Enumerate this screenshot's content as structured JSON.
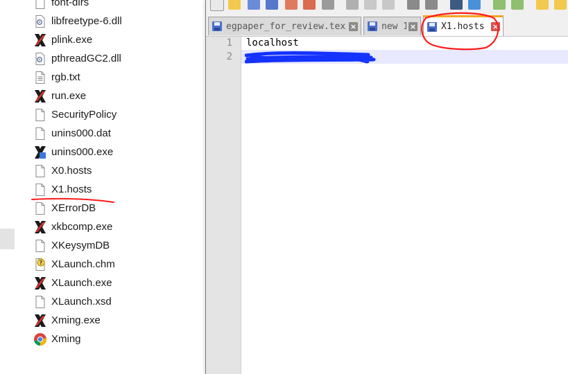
{
  "files": [
    {
      "name": "font-dirs",
      "icon": "document-icon"
    },
    {
      "name": "libfreetype-6.dll",
      "icon": "dll-gear-icon"
    },
    {
      "name": "plink.exe",
      "icon": "x-app-icon"
    },
    {
      "name": "pthreadGC2.dll",
      "icon": "dll-gear-icon"
    },
    {
      "name": "rgb.txt",
      "icon": "text-file-icon"
    },
    {
      "name": "run.exe",
      "icon": "x-app-icon"
    },
    {
      "name": "SecurityPolicy",
      "icon": "document-icon"
    },
    {
      "name": "unins000.dat",
      "icon": "document-icon"
    },
    {
      "name": "unins000.exe",
      "icon": "uninstall-icon"
    },
    {
      "name": "X0.hosts",
      "icon": "document-icon"
    },
    {
      "name": "X1.hosts",
      "icon": "document-icon"
    },
    {
      "name": "XErrorDB",
      "icon": "document-icon"
    },
    {
      "name": "xkbcomp.exe",
      "icon": "x-app-icon"
    },
    {
      "name": "XKeysymDB",
      "icon": "document-icon"
    },
    {
      "name": "XLaunch.chm",
      "icon": "help-file-icon"
    },
    {
      "name": "XLaunch.exe",
      "icon": "x-app-icon"
    },
    {
      "name": "XLaunch.xsd",
      "icon": "document-icon"
    },
    {
      "name": "Xming.exe",
      "icon": "x-app-icon"
    },
    {
      "name": "Xming",
      "icon": "chrome-icon"
    }
  ],
  "editor": {
    "tabs": [
      {
        "label": "egpaper_for_review.tex",
        "active": false
      },
      {
        "label": "new 1",
        "active": false
      },
      {
        "label": "X1.hosts",
        "active": true
      }
    ],
    "lines": [
      {
        "number": "1",
        "text": "localhost"
      },
      {
        "number": "2",
        "text": ""
      }
    ]
  },
  "colors": {
    "annotation_red": "#ff1a1a",
    "redaction_blue": "#1433ff",
    "active_tab_accent": "#f5a623",
    "current_line": "#e8e8ff"
  }
}
